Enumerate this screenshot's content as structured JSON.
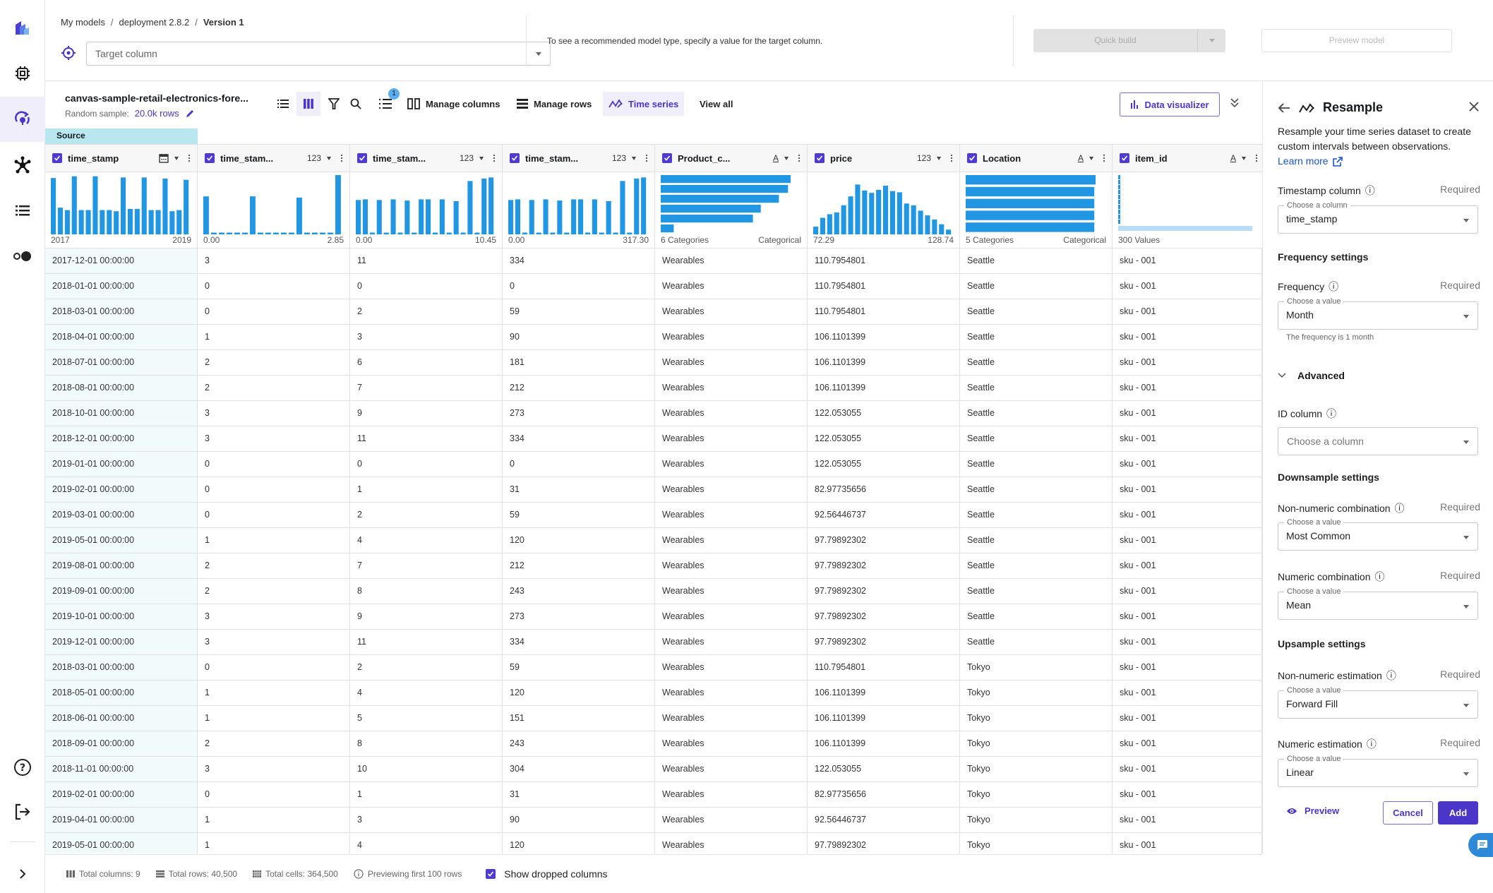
{
  "breadcrumb": {
    "items": [
      "My models",
      "deployment 2.8.2"
    ],
    "current": "Version 1"
  },
  "target": {
    "placeholder": "Target column"
  },
  "hint": "To see a recommended model type, specify a value for the target column.",
  "actions": {
    "quick_build": "Quick build",
    "preview_model": "Preview model"
  },
  "dataset": {
    "name": "canvas-sample-retail-electronics-fore...",
    "sample_label": "Random sample:",
    "sample_rows": "20.0k rows"
  },
  "toolbar": {
    "badge": "1",
    "manage_columns": "Manage columns",
    "manage_rows": "Manage rows",
    "time_series": "Time series",
    "view_all": "View all",
    "data_visualizer": "Data visualizer"
  },
  "table": {
    "source_label": "Source",
    "columns": [
      {
        "name": "time_stamp",
        "type": "date",
        "min": "2017",
        "max": "2019"
      },
      {
        "name": "time_stam...",
        "type": "123",
        "min": "0.00",
        "max": "2.85"
      },
      {
        "name": "time_stam...",
        "type": "123",
        "min": "0.00",
        "max": "10.45"
      },
      {
        "name": "time_stam...",
        "type": "123",
        "min": "0.00",
        "max": "317.30"
      },
      {
        "name": "Product_c...",
        "type": "A",
        "min": "6 Categories",
        "max": "Categorical"
      },
      {
        "name": "price",
        "type": "123",
        "min": "72.29",
        "max": "128.74"
      },
      {
        "name": "Location",
        "type": "A",
        "min": "5 Categories",
        "max": "Categorical"
      },
      {
        "name": "item_id",
        "type": "A",
        "min": "300 Values",
        "max": ""
      }
    ],
    "histograms": [
      {
        "kind": "v",
        "values": [
          0.95,
          0.45,
          0.41,
          0.98,
          0.41,
          0.41,
          0.98,
          0.41,
          0.41,
          0.39,
          0.96,
          0.43,
          0.43,
          0.96,
          0.41,
          0.41,
          0.94,
          0.39,
          0.41,
          0.92
        ]
      },
      {
        "kind": "v",
        "values": [
          0.64,
          0.03,
          0.03,
          0.03,
          0.03,
          0.03,
          0.64,
          0.03,
          0.03,
          0.03,
          0.03,
          0.03,
          0.62,
          0.03,
          0.03,
          0.03,
          0.03,
          1.0
        ]
      },
      {
        "kind": "v",
        "values": [
          0.58,
          0.59,
          0.03,
          0.58,
          0.03,
          0.59,
          0.03,
          0.57,
          0.03,
          0.59,
          0.59,
          0.03,
          0.59,
          0.03,
          0.56,
          0.03,
          0.9,
          0.03,
          0.94,
          0.96
        ]
      },
      {
        "kind": "v",
        "values": [
          0.58,
          0.59,
          0.03,
          0.58,
          0.03,
          0.59,
          0.03,
          0.57,
          0.03,
          0.59,
          0.59,
          0.03,
          0.59,
          0.03,
          0.56,
          0.03,
          0.9,
          0.03,
          0.94,
          0.96
        ]
      },
      {
        "kind": "h",
        "values": [
          1.0,
          0.98,
          0.91,
          0.77,
          0.71,
          0.1
        ]
      },
      {
        "kind": "v",
        "values": [
          0.13,
          0.28,
          0.34,
          0.37,
          0.49,
          0.64,
          0.84,
          0.74,
          0.7,
          0.75,
          0.82,
          0.73,
          0.71,
          0.52,
          0.49,
          0.4,
          0.32,
          0.25,
          0.17,
          0.08
        ]
      },
      {
        "kind": "h",
        "values": [
          1.0,
          0.99,
          0.99,
          0.99,
          0.99
        ]
      },
      {
        "kind": "id",
        "values": []
      }
    ],
    "rows": [
      [
        "2017-12-01 00:00:00",
        "3",
        "11",
        "334",
        "Wearables",
        "110.7954801",
        "Seattle",
        "sku - 001"
      ],
      [
        "2018-01-01 00:00:00",
        "0",
        "0",
        "0",
        "Wearables",
        "110.7954801",
        "Seattle",
        "sku - 001"
      ],
      [
        "2018-03-01 00:00:00",
        "0",
        "2",
        "59",
        "Wearables",
        "110.7954801",
        "Seattle",
        "sku - 001"
      ],
      [
        "2018-04-01 00:00:00",
        "1",
        "3",
        "90",
        "Wearables",
        "106.1101399",
        "Seattle",
        "sku - 001"
      ],
      [
        "2018-07-01 00:00:00",
        "2",
        "6",
        "181",
        "Wearables",
        "106.1101399",
        "Seattle",
        "sku - 001"
      ],
      [
        "2018-08-01 00:00:00",
        "2",
        "7",
        "212",
        "Wearables",
        "106.1101399",
        "Seattle",
        "sku - 001"
      ],
      [
        "2018-10-01 00:00:00",
        "3",
        "9",
        "273",
        "Wearables",
        "122.053055",
        "Seattle",
        "sku - 001"
      ],
      [
        "2018-12-01 00:00:00",
        "3",
        "11",
        "334",
        "Wearables",
        "122.053055",
        "Seattle",
        "sku - 001"
      ],
      [
        "2019-01-01 00:00:00",
        "0",
        "0",
        "0",
        "Wearables",
        "122.053055",
        "Seattle",
        "sku - 001"
      ],
      [
        "2019-02-01 00:00:00",
        "0",
        "1",
        "31",
        "Wearables",
        "82.97735656",
        "Seattle",
        "sku - 001"
      ],
      [
        "2019-03-01 00:00:00",
        "0",
        "2",
        "59",
        "Wearables",
        "92.56446737",
        "Seattle",
        "sku - 001"
      ],
      [
        "2019-05-01 00:00:00",
        "1",
        "4",
        "120",
        "Wearables",
        "97.79892302",
        "Seattle",
        "sku - 001"
      ],
      [
        "2019-08-01 00:00:00",
        "2",
        "7",
        "212",
        "Wearables",
        "97.79892302",
        "Seattle",
        "sku - 001"
      ],
      [
        "2019-09-01 00:00:00",
        "2",
        "8",
        "243",
        "Wearables",
        "97.79892302",
        "Seattle",
        "sku - 001"
      ],
      [
        "2019-10-01 00:00:00",
        "3",
        "9",
        "273",
        "Wearables",
        "97.79892302",
        "Seattle",
        "sku - 001"
      ],
      [
        "2019-12-01 00:00:00",
        "3",
        "11",
        "334",
        "Wearables",
        "97.79892302",
        "Seattle",
        "sku - 001"
      ],
      [
        "2018-03-01 00:00:00",
        "0",
        "2",
        "59",
        "Wearables",
        "110.7954801",
        "Tokyo",
        "sku - 001"
      ],
      [
        "2018-05-01 00:00:00",
        "1",
        "4",
        "120",
        "Wearables",
        "106.1101399",
        "Tokyo",
        "sku - 001"
      ],
      [
        "2018-06-01 00:00:00",
        "1",
        "5",
        "151",
        "Wearables",
        "106.1101399",
        "Tokyo",
        "sku - 001"
      ],
      [
        "2018-09-01 00:00:00",
        "2",
        "8",
        "243",
        "Wearables",
        "106.1101399",
        "Tokyo",
        "sku - 001"
      ],
      [
        "2018-11-01 00:00:00",
        "3",
        "10",
        "304",
        "Wearables",
        "122.053055",
        "Tokyo",
        "sku - 001"
      ],
      [
        "2019-02-01 00:00:00",
        "0",
        "1",
        "31",
        "Wearables",
        "82.97735656",
        "Tokyo",
        "sku - 001"
      ],
      [
        "2019-04-01 00:00:00",
        "1",
        "3",
        "90",
        "Wearables",
        "92.56446737",
        "Tokyo",
        "sku - 001"
      ],
      [
        "2019-05-01 00:00:00",
        "1",
        "4",
        "120",
        "Wearables",
        "97.79892302",
        "Tokyo",
        "sku - 001"
      ]
    ]
  },
  "footer": {
    "total_columns": "Total columns: 9",
    "total_rows": "Total rows: 40,500",
    "total_cells": "Total cells: 364,500",
    "previewing": "Previewing first 100 rows",
    "show_dropped": "Show dropped columns"
  },
  "panel": {
    "title": "Resample",
    "description": "Resample your time series dataset to create custom intervals between observations.",
    "learn_more": "Learn more",
    "required": "Required",
    "timestamp_label": "Timestamp column",
    "timestamp_float": "Choose a column",
    "timestamp_value": "time_stamp",
    "frequency_section": "Frequency settings",
    "frequency_label": "Frequency",
    "frequency_float": "Choose a value",
    "frequency_value": "Month",
    "frequency_helper": "The frequency is 1 month",
    "advanced": "Advanced",
    "id_label": "ID column",
    "id_placeholder": "Choose a column",
    "downsample_section": "Downsample settings",
    "nn_comb_label": "Non-numeric combination",
    "nn_comb_float": "Choose a value",
    "nn_comb_value": "Most Common",
    "n_comb_label": "Numeric combination",
    "n_comb_float": "Choose a value",
    "n_comb_value": "Mean",
    "upsample_section": "Upsample settings",
    "nn_est_label": "Non-numeric estimation",
    "nn_est_float": "Choose a value",
    "nn_est_value": "Forward Fill",
    "n_est_label": "Numeric estimation",
    "n_est_float": "Choose a value",
    "n_est_value": "Linear",
    "preview": "Preview",
    "cancel": "Cancel",
    "add": "Add"
  },
  "colors": {
    "accent": "#4a36c9",
    "bar": "#2196e3",
    "source": "#b9e7ef"
  }
}
